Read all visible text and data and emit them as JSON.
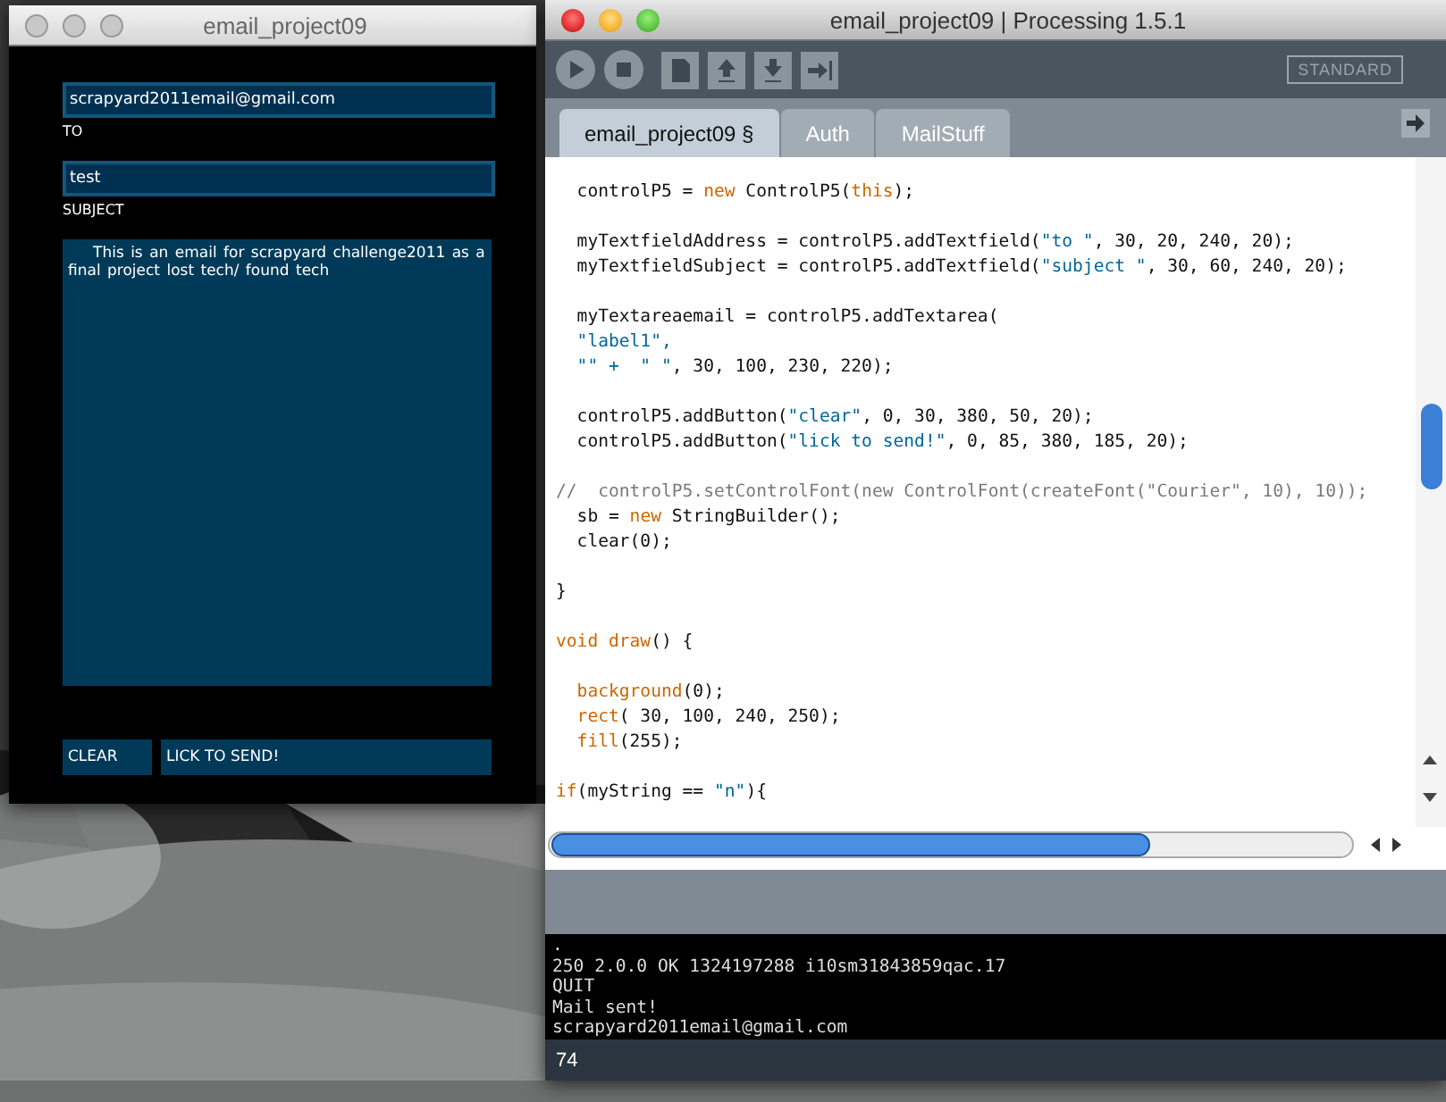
{
  "sketch_window": {
    "title": "email_project09",
    "to_field": {
      "value": "scrapyard2011email@gmail.com",
      "label": "TO"
    },
    "subject_field": {
      "value": "test",
      "label": "SUBJECT"
    },
    "message_area": {
      "value": "This is an email for scrapyard challenge2011 as a final project lost tech/ found tech"
    },
    "buttons": [
      "CLEAR",
      "LICK TO SEND!"
    ]
  },
  "editor_window": {
    "title": "email_project09 | Processing 1.5.1",
    "mode": "STANDARD",
    "tabs": [
      {
        "label": "email_project09 §",
        "selected": true
      },
      {
        "label": "Auth",
        "selected": false
      },
      {
        "label": "MailStuff",
        "selected": false
      }
    ],
    "code_lines": [
      {
        "kind": "code",
        "segments": [
          {
            "kind": "plain",
            "text": "  controlP5 = "
          },
          {
            "kind": "keyword",
            "text": "new"
          },
          {
            "kind": "plain",
            "text": " ControlP5("
          },
          {
            "kind": "keyword",
            "text": "this"
          },
          {
            "kind": "plain",
            "text": ");"
          }
        ]
      },
      {
        "kind": "blank"
      },
      {
        "kind": "code",
        "segments": [
          {
            "kind": "plain",
            "text": "  myTextfieldAddress = controlP5.addTextfield("
          },
          {
            "kind": "string",
            "text": "\"to \""
          },
          {
            "kind": "plain",
            "text": ", 30, 20, 240, 20);"
          }
        ]
      },
      {
        "kind": "code",
        "segments": [
          {
            "kind": "plain",
            "text": "  myTextfieldSubject = controlP5.addTextfield("
          },
          {
            "kind": "string",
            "text": "\"subject \""
          },
          {
            "kind": "plain",
            "text": ", 30, 60, 240, 20);"
          }
        ]
      },
      {
        "kind": "blank"
      },
      {
        "kind": "code",
        "segments": [
          {
            "kind": "plain",
            "text": "  myTextareaemail = controlP5.addTextarea("
          }
        ]
      },
      {
        "kind": "code",
        "segments": [
          {
            "kind": "string",
            "text": "  \"label1\","
          }
        ]
      },
      {
        "kind": "code",
        "segments": [
          {
            "kind": "string",
            "text": "  \"\" +  \" \""
          },
          {
            "kind": "plain",
            "text": ", 30, 100, 230, 220);"
          }
        ]
      },
      {
        "kind": "blank"
      },
      {
        "kind": "code",
        "segments": [
          {
            "kind": "plain",
            "text": "  controlP5.addButton("
          },
          {
            "kind": "string",
            "text": "\"clear\""
          },
          {
            "kind": "plain",
            "text": ", 0, 30, 380, 50, 20);"
          }
        ]
      },
      {
        "kind": "code",
        "segments": [
          {
            "kind": "plain",
            "text": "  controlP5.addButton("
          },
          {
            "kind": "string",
            "text": "\"lick to send!\""
          },
          {
            "kind": "plain",
            "text": ", 0, 85, 380, 185, 20);"
          }
        ]
      },
      {
        "kind": "blank"
      },
      {
        "kind": "code",
        "segments": [
          {
            "kind": "comment",
            "text": "//  controlP5.setControlFont(new ControlFont(createFont(\"Courier\", 10), 10));"
          }
        ]
      },
      {
        "kind": "code",
        "segments": [
          {
            "kind": "plain",
            "text": "  sb = "
          },
          {
            "kind": "keyword",
            "text": "new"
          },
          {
            "kind": "plain",
            "text": " StringBuilder();"
          }
        ]
      },
      {
        "kind": "code",
        "segments": [
          {
            "kind": "plain",
            "text": "  clear(0);"
          }
        ]
      },
      {
        "kind": "blank"
      },
      {
        "kind": "code",
        "segments": [
          {
            "kind": "plain",
            "text": "}"
          }
        ]
      },
      {
        "kind": "blank"
      },
      {
        "kind": "code",
        "segments": [
          {
            "kind": "keyword",
            "text": "void draw"
          },
          {
            "kind": "plain",
            "text": "() {"
          }
        ]
      },
      {
        "kind": "blank"
      },
      {
        "kind": "code",
        "segments": [
          {
            "kind": "keyword",
            "text": "  background"
          },
          {
            "kind": "plain",
            "text": "(0);"
          }
        ]
      },
      {
        "kind": "code",
        "segments": [
          {
            "kind": "keyword",
            "text": "  rect"
          },
          {
            "kind": "plain",
            "text": "( 30, 100, 240, 250);"
          }
        ]
      },
      {
        "kind": "code",
        "segments": [
          {
            "kind": "keyword",
            "text": "  fill"
          },
          {
            "kind": "plain",
            "text": "(255);"
          }
        ]
      },
      {
        "kind": "blank"
      },
      {
        "kind": "code",
        "segments": [
          {
            "kind": "keyword",
            "text": "if"
          },
          {
            "kind": "plain",
            "text": "(myString == "
          },
          {
            "kind": "string",
            "text": "\"n\""
          },
          {
            "kind": "plain",
            "text": "){"
          }
        ]
      }
    ],
    "console_lines": [
      ".",
      "250 2.0.0 OK 1324197288 i10sm31843859qac.17",
      "QUIT",
      "Mail sent!",
      "scrapyard2011email@gmail.com"
    ],
    "line_number": "74"
  }
}
